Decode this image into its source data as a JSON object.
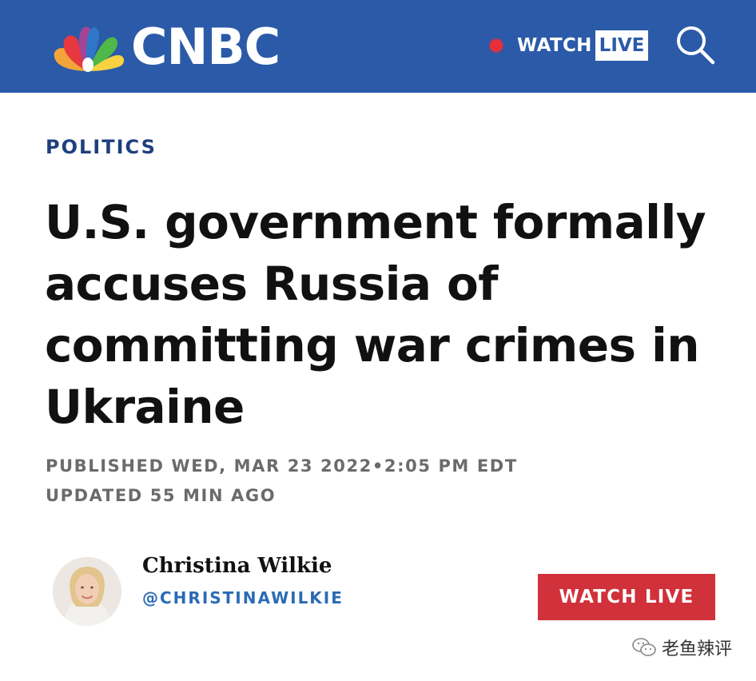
{
  "header": {
    "logo_text": "CNBC",
    "watch_label": "WATCH",
    "live_label": "LIVE",
    "brand_color": "#2b5aa8",
    "live_dot_color": "#e8303a",
    "search_icon": "search-icon"
  },
  "article": {
    "section": "POLITICS",
    "headline": "U.S. government formally accuses Russia of committing war crimes in Ukraine",
    "published": "PUBLISHED WED, MAR 23 2022•2:05 PM EDT",
    "updated": "UPDATED 55 MIN AGO"
  },
  "author": {
    "name": "Christina Wilkie",
    "handle": "@CHRISTINAWILKIE",
    "avatar_icon": "author-avatar"
  },
  "watch_live_button": {
    "label": "WATCH LIVE",
    "color": "#d1313a"
  },
  "watermark": {
    "text": "老鱼辣评",
    "icon": "wechat-icon"
  }
}
